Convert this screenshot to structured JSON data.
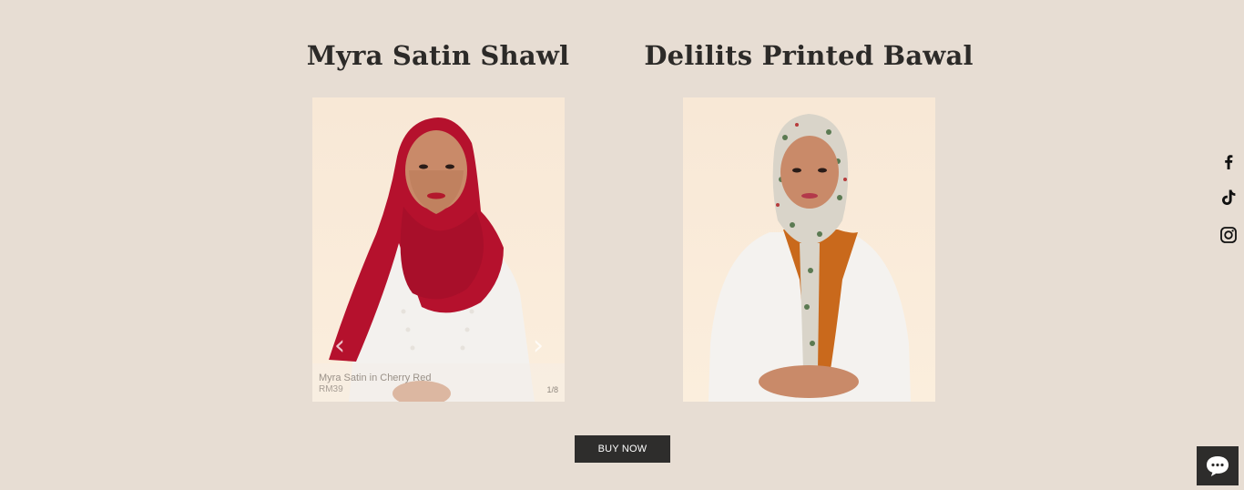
{
  "products": [
    {
      "title": "Myra Satin Shawl",
      "caption_name": "Myra Satin in Cherry Red",
      "caption_price": "RM39",
      "slide_counter": "1/8",
      "scarf_color": "#b5112d"
    },
    {
      "title": "Delilits Printed Bawal",
      "scarf_color": "#d9d4c9"
    }
  ],
  "cta": {
    "buy_label": "BUY NOW"
  },
  "social": {
    "items": [
      "facebook-icon",
      "tiktok-icon",
      "instagram-icon"
    ],
    "facebook_glyph": "f"
  },
  "colors": {
    "background": "#e7ddd3",
    "button": "#2e2d2c"
  }
}
